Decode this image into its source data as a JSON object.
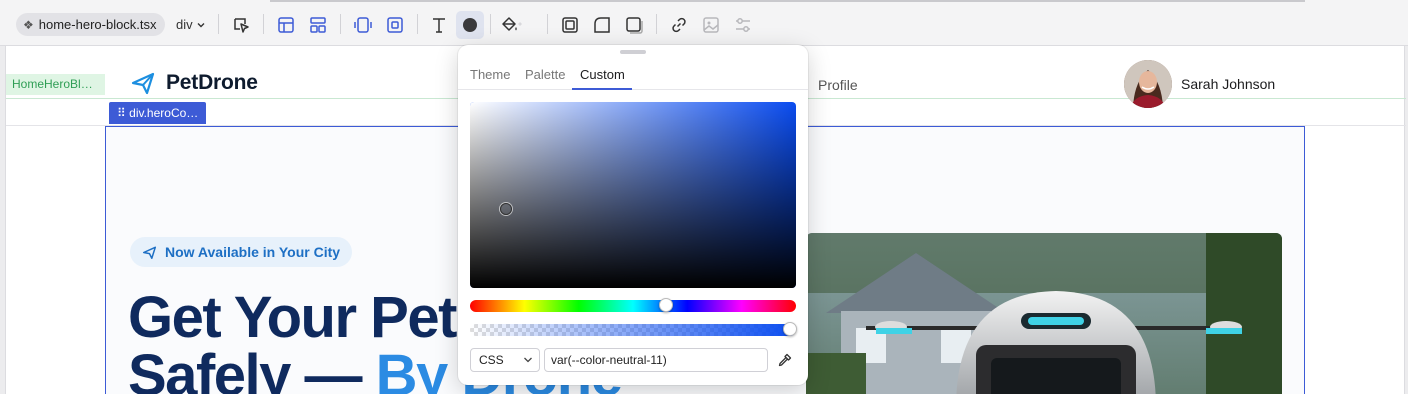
{
  "toolbar": {
    "file_name": "home-hero-block.tsx",
    "element_tag": "div",
    "icons": [
      "select-parent-icon",
      "layout-icon",
      "align-icon",
      "padding-icon",
      "margin-icon",
      "text-icon",
      "color-fill-icon",
      "background-fill-icon",
      "border-icon",
      "radius-icon",
      "shadow-icon",
      "link-icon",
      "image-icon",
      "settings-icon"
    ]
  },
  "canvas": {
    "component_label": "HomeHeroBl…",
    "brand_name": "PetDrone",
    "nav_profile": "Profile",
    "user_name": "Sarah Johnson",
    "selected_element_label": "div.heroCo…",
    "badge_text": "Now Available in Your City",
    "headline_line1": "Get Your Pet",
    "headline_line2a": "Safely — ",
    "headline_line2b": "By Drone"
  },
  "color_picker": {
    "tabs": [
      {
        "label": "Theme",
        "active": false
      },
      {
        "label": "Palette",
        "active": false
      },
      {
        "label": "Custom",
        "active": true
      }
    ],
    "base_hue_color": "#0a4cf0",
    "hue_fraction": 0.6,
    "format": "CSS",
    "value": "var(--color-neutral-11)"
  },
  "colors": {
    "accent": "#3d5bd6",
    "headline": "#0f2a5e",
    "headline_highlight": "#2b8be3",
    "badge_text": "#1d6fc4"
  }
}
